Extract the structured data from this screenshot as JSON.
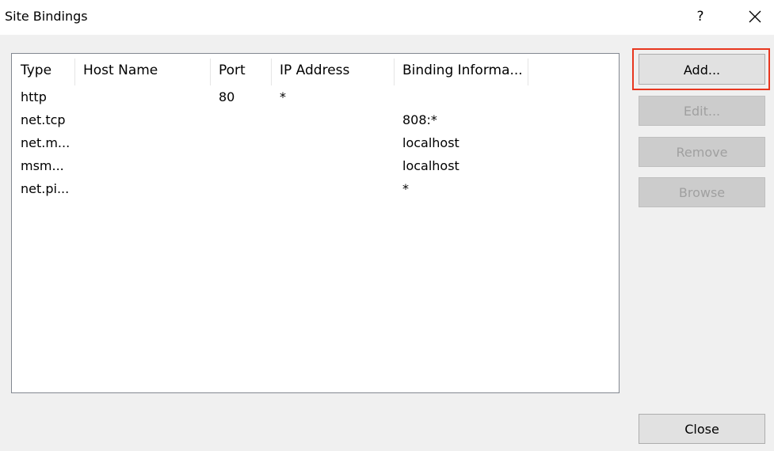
{
  "window": {
    "title": "Site Bindings",
    "help_label": "?"
  },
  "table": {
    "columns": [
      "Type",
      "Host Name",
      "Port",
      "IP Address",
      "Binding Informa..."
    ],
    "rows": [
      [
        "http",
        "",
        "80",
        "*",
        ""
      ],
      [
        "net.tcp",
        "",
        "",
        "",
        "808:*"
      ],
      [
        "net.m...",
        "",
        "",
        "",
        "localhost"
      ],
      [
        "msm...",
        "",
        "",
        "",
        "localhost"
      ],
      [
        "net.pi...",
        "",
        "",
        "",
        "*"
      ]
    ]
  },
  "buttons": {
    "add": "Add...",
    "edit": "Edit...",
    "remove": "Remove",
    "browse": "Browse",
    "close": "Close"
  },
  "colors": {
    "highlight": "#e8371f"
  }
}
